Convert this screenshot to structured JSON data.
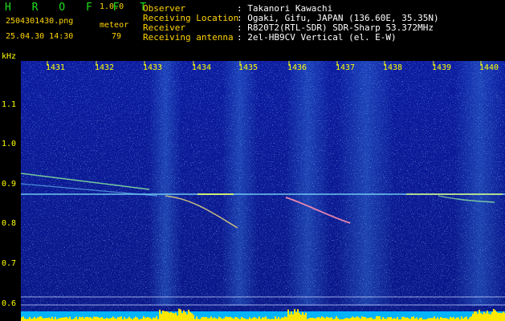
{
  "app": {
    "title": "H R O F F T",
    "version": "1.0.0",
    "filename": "2504301430.png",
    "mode": "meteor",
    "datetime": "25.04.30 14:30",
    "count": "79"
  },
  "info": {
    "labels": [
      "Observer",
      "Receiving Location",
      "Receiver",
      "Receiving antenna"
    ],
    "values": [
      ": Takanori Kawachi",
      ": Ogaki, Gifu, JAPAN (136.60E, 35.35N)",
      ": R820T2(RTL-SDR) SDR-Sharp 53.372MHz",
      ": 2el-HB9CV Vertical (el. E-W)"
    ]
  },
  "axis": {
    "y_unit": "kHz",
    "x_ticks": [
      "1431",
      "1432",
      "1433",
      "1434",
      "1435",
      "1436",
      "1437",
      "1438",
      "1439",
      "1440"
    ],
    "y_ticks": [
      "1.1",
      "1.0",
      "0.9",
      "0.8",
      "0.7",
      "0.6"
    ]
  },
  "colors": {
    "background": "#000000",
    "header_green": "#1ee11e",
    "header_yellow": "#ffd400",
    "tick_yellow": "#ffff00",
    "spectrogram_blue": "#0a1a96",
    "level_yellow": "#ffe800",
    "level_cyan": "#00c8ff"
  }
}
